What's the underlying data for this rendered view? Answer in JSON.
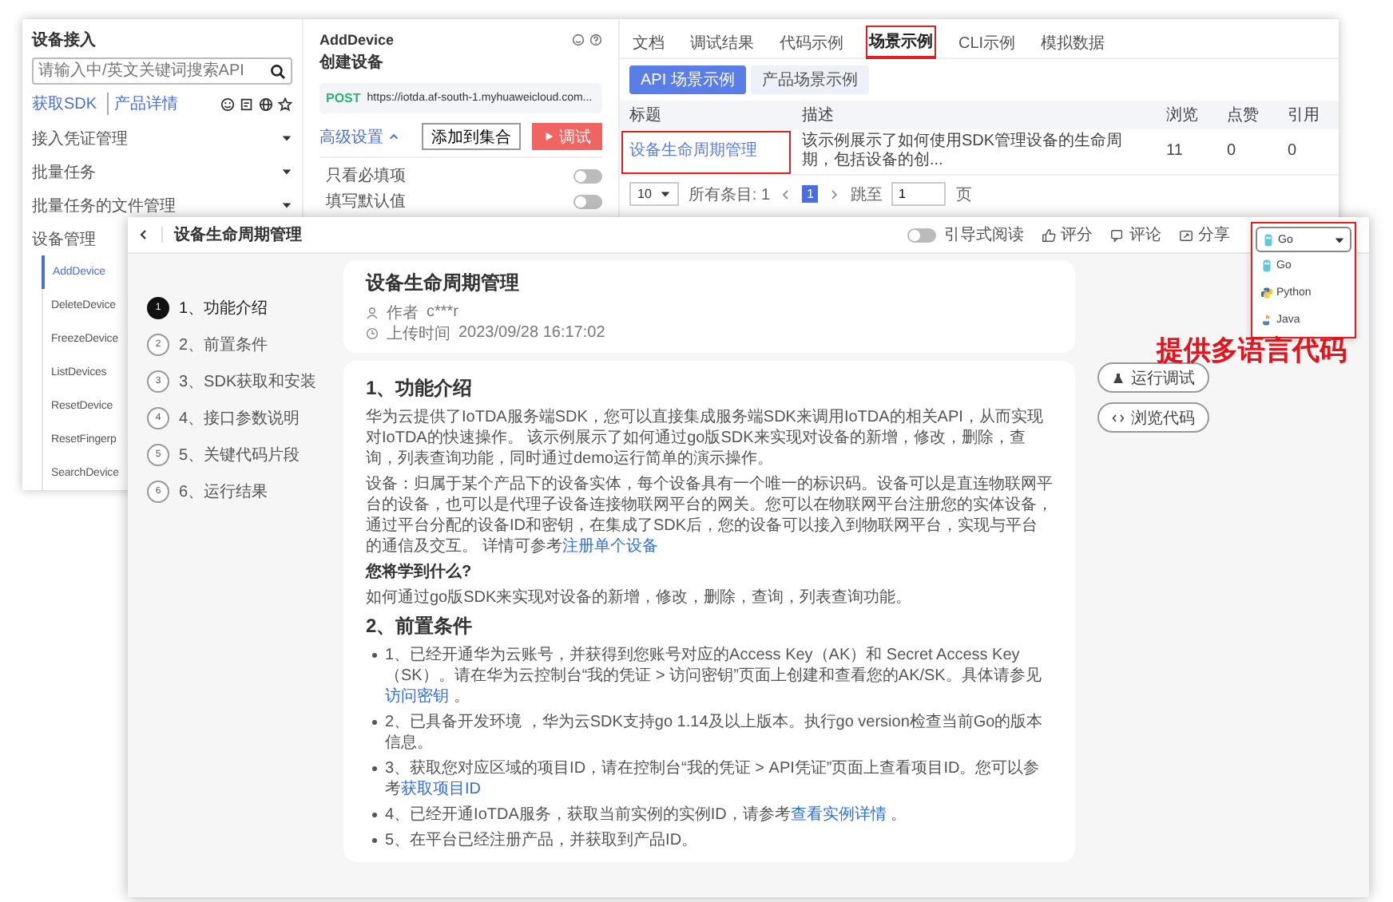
{
  "back_window": {
    "sidebar": {
      "title": "设备接入",
      "search": {
        "placeholder": "请输入中/英文关键词搜索API"
      },
      "links": [
        "获取SDK",
        "产品详情"
      ],
      "items": [
        {
          "label": "接入凭证管理",
          "expanded": false
        },
        {
          "label": "批量任务",
          "expanded": false
        },
        {
          "label": "批量任务的文件管理",
          "expanded": false
        },
        {
          "label": "设备管理",
          "children": [
            {
              "label": "AddDevice",
              "selected": true
            },
            {
              "label": "DeleteDevice",
              "selected": false
            },
            {
              "label": "FreezeDevice",
              "selected": false
            },
            {
              "label": "ListDevices",
              "selected": false
            },
            {
              "label": "ResetDevice",
              "selected": false
            },
            {
              "label": "ResetFingerp",
              "selected": false
            },
            {
              "label": "SearchDevice",
              "selected": false
            }
          ]
        }
      ]
    },
    "api": {
      "name": "AddDevice",
      "title": "创建设备",
      "method": "POST",
      "url": "https://iotda.af-south-1.myhuaweicloud.com...",
      "advanced_link": "高级设置",
      "buttons": [
        {
          "label": "添加到集合",
          "kind": "secondary"
        },
        {
          "label": "调试",
          "kind": "primary"
        }
      ],
      "toggles": [
        {
          "label": "只看必填项",
          "on": false
        },
        {
          "label": "填写默认值",
          "on": false
        }
      ]
    },
    "tabs": [
      {
        "label": "文档",
        "selected": false,
        "highlighted": false
      },
      {
        "label": "调试结果",
        "selected": false,
        "highlighted": false
      },
      {
        "label": "代码示例",
        "selected": false,
        "highlighted": false
      },
      {
        "label": "场景示例",
        "selected": true,
        "highlighted": true
      },
      {
        "label": "CLI示例",
        "selected": false,
        "highlighted": false
      },
      {
        "label": "模拟数据",
        "selected": false,
        "highlighted": false
      }
    ],
    "sub_tabs": [
      {
        "label": "API 场景示例",
        "selected": true
      },
      {
        "label": "产品场景示例",
        "selected": false
      }
    ],
    "table": {
      "columns": [
        "标题",
        "描述",
        "浏览",
        "点赞",
        "引用"
      ],
      "rows": [
        {
          "cells": [
            "设备生命周期管理",
            "该示例展示了如何使用SDK管理设备的生命周期，包括设备的创...",
            "11",
            "0",
            "0"
          ],
          "highlighted": true
        }
      ]
    },
    "pagination": {
      "page_size": "10",
      "total": "所有条目: 1",
      "pages": [
        {
          "label": "1",
          "selected": true
        }
      ],
      "goto_label": "跳至",
      "goto_value": "1",
      "page_unit": "页"
    }
  },
  "front_window": {
    "title": "设备生命周期管理",
    "guided_reading": {
      "label": "引导式阅读",
      "on": false
    },
    "actions": [
      {
        "label": "评分",
        "kind": "rate"
      },
      {
        "label": "评论",
        "kind": "comment"
      },
      {
        "label": "分享",
        "kind": "share"
      }
    ],
    "language": {
      "value": "Go",
      "kind": "go",
      "highlighted": true,
      "options": [
        {
          "label": "Go",
          "kind": "go"
        },
        {
          "label": "Python",
          "kind": "python"
        },
        {
          "label": "Java",
          "kind": "java"
        }
      ]
    },
    "steps": [
      {
        "number": "1",
        "label": "1、功能介绍",
        "selected": true
      },
      {
        "number": "2",
        "label": "2、前置条件",
        "selected": false
      },
      {
        "number": "3",
        "label": "3、SDK获取和安装",
        "selected": false
      },
      {
        "number": "4",
        "label": "4、接口参数说明",
        "selected": false
      },
      {
        "number": "5",
        "label": "5、关键代码片段",
        "selected": false
      },
      {
        "number": "6",
        "label": "6、运行结果",
        "selected": false
      }
    ],
    "header": {
      "title": "设备生命周期管理",
      "author_label": "作者",
      "author": "c***r",
      "time_label": "上传时间",
      "time": "2023/09/28 16:17:02"
    },
    "sections": [
      {
        "heading": "1、功能介绍",
        "blocks": [
          {
            "kind": "paragraph",
            "parts": [
              {
                "text": "华为云提供了IoTDA服务端SDK，您可以直接集成服务端SDK来调用IoTDA的相关API，从而实现对IoTDA的快速操作。 该示例展示了如何通过go版SDK来实现对设备的新增，修改，删除，查询，列表查询功能，同时通过demo运行简单的演示操作。"
              }
            ]
          },
          {
            "kind": "paragraph",
            "parts": [
              {
                "text": "设备：归属于某个产品下的设备实体，每个设备具有一个唯一的标识码。设备可以是直连物联网平台的设备，也可以是代理子设备连接物联网平台的网关。您可以在物联网平台注册您的实体设备，通过平台分配的设备ID和密钥，在集成了SDK后，您的设备可以接入到物联网平台，实现与平台的通信及交互。 详情可参考"
              },
              {
                "text": "注册单个设备",
                "link": true
              }
            ]
          },
          {
            "kind": "subheading",
            "parts": [
              {
                "text": "您将学到什么?"
              }
            ]
          },
          {
            "kind": "paragraph",
            "parts": [
              {
                "text": "如何通过go版SDK来实现对设备的新增，修改，删除，查询，列表查询功能。"
              }
            ]
          }
        ]
      },
      {
        "heading": "2、前置条件",
        "blocks": [
          {
            "kind": "bullet",
            "parts": [
              {
                "text": "1、已经开通华为云账号，并获得到您账号对应的Access Key（AK）和 Secret Access Key（SK）。请在华为云控制台“我的凭证 > 访问密钥”页面上创建和查看您的AK/SK。具体请参见 "
              },
              {
                "text": "访问密钥",
                "link": true
              },
              {
                "text": " 。"
              }
            ]
          },
          {
            "kind": "bullet",
            "parts": [
              {
                "text": "2、已具备开发环境 ，华为云SDK支持go 1.14及以上版本。执行go version检查当前Go的版本信息。"
              }
            ]
          },
          {
            "kind": "bullet",
            "parts": [
              {
                "text": "3、获取您对应区域的项目ID，请在控制台“我的凭证 > API凭证”页面上查看项目ID。您可以参考"
              },
              {
                "text": "获取项目ID",
                "link": true
              }
            ]
          },
          {
            "kind": "bullet",
            "parts": [
              {
                "text": "4、已经开通IoTDA服务，获取当前实例的实例ID，请参考"
              },
              {
                "text": "查看实例详情",
                "link": true
              },
              {
                "text": " 。"
              }
            ]
          },
          {
            "kind": "bullet",
            "parts": [
              {
                "text": "5、在平台已经注册产品，并获取到产品ID。"
              }
            ]
          }
        ]
      }
    ],
    "side_buttons": [
      {
        "label": "运行调试",
        "kind": "run"
      },
      {
        "label": "浏览代码",
        "kind": "code"
      }
    ]
  },
  "annotation": "提供多语言代码"
}
